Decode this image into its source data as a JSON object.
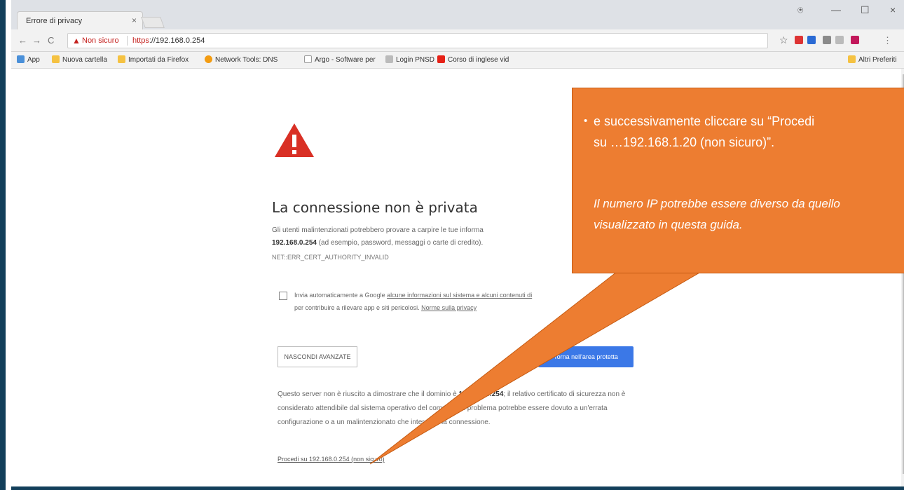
{
  "browser": {
    "tab_title": "Errore di privacy",
    "tab_close": "×",
    "window_controls": {
      "account": "⍟",
      "minimize": "—",
      "maximize": "☐",
      "close": "×"
    },
    "nav": {
      "back": "←",
      "forward": "→",
      "reload": "C"
    },
    "omnibox": {
      "security_label": "Non sicuro",
      "url_scheme": "https",
      "url_rest": "://192.168.0.254"
    },
    "menu": "⋮"
  },
  "bookmarks": {
    "items": [
      "App",
      "Nuova cartella",
      "Importati da Firefox",
      "Network Tools: DNS",
      "Argo - Software per",
      "Login PNSD",
      "Corso di inglese vid"
    ],
    "other": "Altri Preferiti"
  },
  "page": {
    "heading": "La connessione non è privata",
    "body1_start": "Gli utenti malintenzionati potrebbero provare a carpire le tue informa",
    "body1_host": "192.168.0.254",
    "body1_end": " (ad esempio, password, messaggi o carte di credito).",
    "error_code": "NET::ERR_CERT_AUTHORITY_INVALID",
    "checkbox_text_start": "Invia automaticamente a Google ",
    "checkbox_link1": "alcune informazioni sul sistema e alcuni contenuti di",
    "checkbox_text_mid": "per contribuire a rilevare app e siti pericolosi. ",
    "checkbox_link2": "Norme sulla privacy",
    "advanced_button": "NASCONDI AVANZATE",
    "back_button": "Torna nell'area protetta",
    "body2_start": "Questo server non è riuscito a dimostrare che il dominio è ",
    "body2_host": "192.168.0.254",
    "body2_end": "; il relativo certificato di sicurezza non è considerato attendibile dal sistema operativo del computer. Il problema potrebbe essere dovuto a un'errata configurazione o a un malintenzionato che intercetta la connessione.",
    "proceed_link": "Procedi su 192.168.0.254 (non sicuro)"
  },
  "callout": {
    "bullet": "•",
    "line1": "e successivamente cliccare su “Procedi",
    "line2": "su …192.168.1.20 (non sicuro)”.",
    "note": "Il numero IP potrebbe essere diverso da quello visualizzato in questa guida."
  },
  "colors": {
    "callout": "#ed7d31",
    "warning": "#c5221f",
    "primary_button": "#3b78e7"
  }
}
